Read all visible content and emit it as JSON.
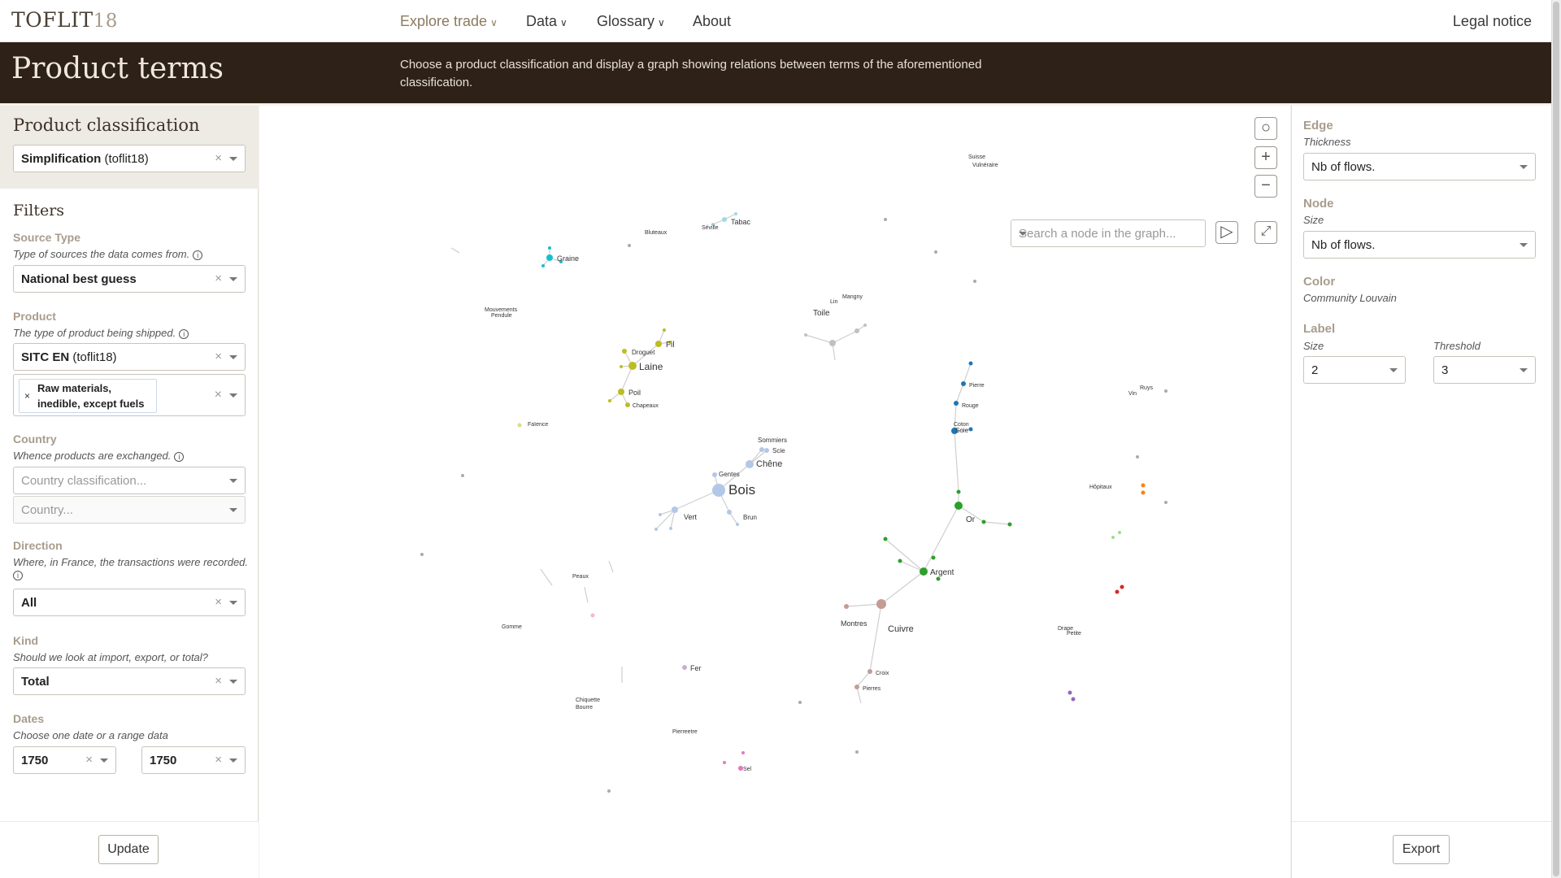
{
  "nav": {
    "logo_text": "TOFLIT",
    "logo_num": "18",
    "items": [
      {
        "label": "Explore trade",
        "active": true,
        "dropdown": true
      },
      {
        "label": "Data",
        "active": false,
        "dropdown": true
      },
      {
        "label": "Glossary",
        "active": false,
        "dropdown": true
      },
      {
        "label": "About",
        "active": false,
        "dropdown": false
      }
    ],
    "legal": "Legal notice"
  },
  "banner": {
    "title": "Product terms",
    "description": "Choose a product classification and display a graph showing relations between terms of the aforementioned classification."
  },
  "left": {
    "classification_title": "Product classification",
    "classification_value_bold": "Simplification",
    "classification_value_rest": " (toflit18)",
    "filters_title": "Filters",
    "source_type": {
      "label": "Source Type",
      "hint": "Type of sources the data comes from.",
      "value": "National best guess"
    },
    "product": {
      "label": "Product",
      "hint": "The type of product being shipped.",
      "value_bold": "SITC EN",
      "value_rest": " (toflit18)",
      "tag": "Raw materials, inedible, except fuels"
    },
    "country": {
      "label": "Country",
      "hint": "Whence products are exchanged.",
      "placeholder1": "Country classification...",
      "placeholder2": "Country..."
    },
    "direction": {
      "label": "Direction",
      "hint": "Where, in France, the transactions were recorded.",
      "value": "All"
    },
    "kind": {
      "label": "Kind",
      "hint": "Should we look at import, export, or total?",
      "value": "Total"
    },
    "dates": {
      "label": "Dates",
      "hint": "Choose one date or a range data",
      "from": "1750",
      "to": "1750"
    },
    "update_button": "Update"
  },
  "graph": {
    "search_placeholder": "Search a node in the graph...",
    "node_labels_big": [
      "Bois",
      "Laine",
      "Argent",
      "Cuivre",
      "Toile"
    ],
    "labels": {
      "bois": "Bois",
      "chene": "Chêne",
      "sommiers": "Sommiers",
      "scie": "Scie",
      "gentes": "Gentes",
      "vert": "Vert",
      "brun": "Brun",
      "laine": "Laine",
      "fil": "Fil",
      "droguet": "Droguet",
      "poil": "Poil",
      "chapeaux": "Chapeaux",
      "tabac": "Tabac",
      "seville": "Séville",
      "graine": "Graine",
      "bluteaux": "Bluteaux",
      "suisse": "Suisse",
      "vulneraire": "Vulnéraire",
      "toile": "Toile",
      "mangny": "Mangny",
      "lin": "Lin",
      "mouvements": "Mouvements",
      "pendule": "Pendule",
      "faience": "Faïence",
      "pierre": "Pierre",
      "rouge": "Rouge",
      "coton": "Coton",
      "soie": "Soie",
      "or": "Or",
      "argent": "Argent",
      "montres": "Montres",
      "cuivre": "Cuivre",
      "croix": "Croix",
      "pierres": "Pierres",
      "peaux": "Peaux",
      "gomme": "Gomme",
      "fer": "Fer",
      "chiquette": "Chiquette",
      "bourre": "Bourre",
      "pierreetre": "Pierreetre",
      "sel": "Sel",
      "hopitaux": "Hôpitaux",
      "ruys": "Ruys",
      "vin": "Vin",
      "drape": "Drape",
      "petite": "Petite"
    }
  },
  "right": {
    "edge_label": "Edge",
    "edge_hint": "Thickness",
    "edge_value": "Nb of flows.",
    "node_label": "Node",
    "node_hint": "Size",
    "node_value": "Nb of flows.",
    "color_label": "Color",
    "color_value": "Community Louvain",
    "label_label": "Label",
    "label_size_hint": "Size",
    "label_size": "2",
    "label_threshold_hint": "Threshold",
    "label_threshold": "3",
    "export_button": "Export"
  },
  "colors": {
    "banner": "#2e2218",
    "accent": "#8c7a60",
    "label": "#a89c8c"
  }
}
